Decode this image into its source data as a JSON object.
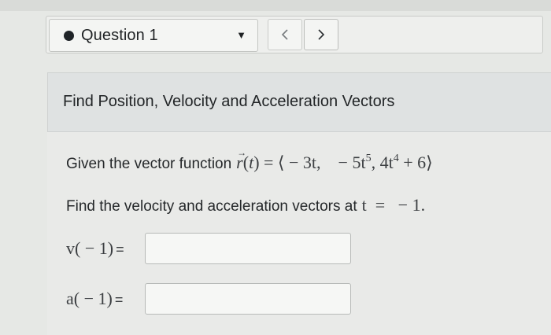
{
  "question_nav": {
    "question_label": "Question 1",
    "dropdown_icon": "caret-down-icon",
    "prev_icon": "chevron-left-icon",
    "next_icon": "chevron-right-icon"
  },
  "problem": {
    "heading": "Find Position, Velocity and Acceleration Vectors",
    "given_prefix": "Given the vector function",
    "vector_function": {
      "lhs": "r(t)",
      "component_1": "− 3t,",
      "component_2_coef": "− 5t",
      "component_2_exp": "5",
      "component_3_coef": "4t",
      "component_3_exp": "4",
      "component_3_tail": "+ 6"
    },
    "find_prefix": "Find the velocity and acceleration vectors at",
    "find_condition": "t  =   − 1."
  },
  "answers": {
    "velocity_label": "v( − 1)",
    "velocity_value": "",
    "acceleration_label": "a( − 1)",
    "acceleration_value": "",
    "equals": "="
  }
}
